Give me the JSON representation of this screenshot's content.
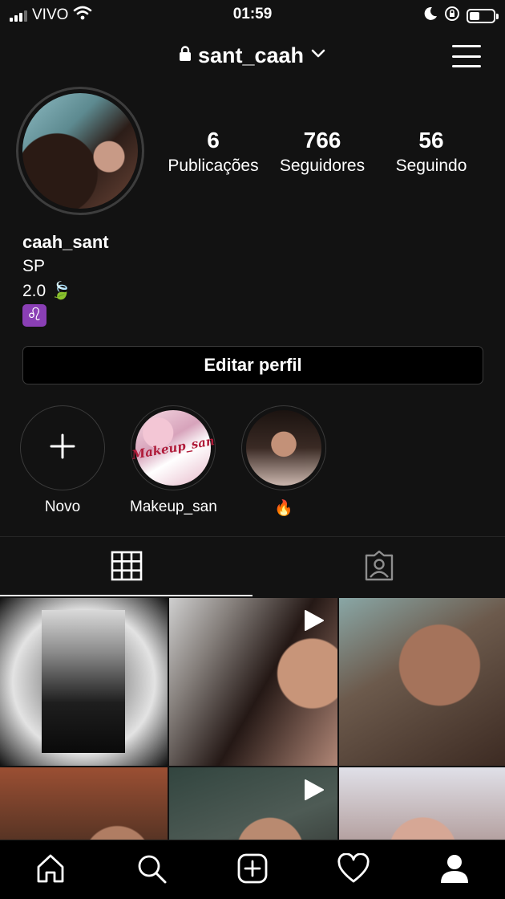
{
  "status_bar": {
    "carrier": "VIVO",
    "time": "01:59"
  },
  "header": {
    "username": "sant_caah"
  },
  "profile": {
    "stats": [
      {
        "value": "6",
        "label": "Publicações"
      },
      {
        "value": "766",
        "label": "Seguidores"
      },
      {
        "value": "56",
        "label": "Seguindo"
      }
    ],
    "bio": {
      "name": "caah_sant",
      "line1": "SP",
      "line2_text": "2.0",
      "line2_emoji": "🍃",
      "line3_emoji": "♌"
    },
    "edit_button": "Editar perfil"
  },
  "highlights": [
    {
      "label": "Novo"
    },
    {
      "label": "Makeup_san",
      "cover_text": "Makeup_san"
    },
    {
      "label": "🔥"
    }
  ],
  "tabs": [
    "grid-posts",
    "tagged-posts"
  ],
  "posts": [
    {
      "type": "photo"
    },
    {
      "type": "video"
    },
    {
      "type": "photo"
    },
    {
      "type": "photo"
    },
    {
      "type": "video"
    },
    {
      "type": "photo"
    }
  ],
  "bottom_nav": [
    "home-icon",
    "search-icon",
    "new-post-icon",
    "activity-heart-icon",
    "profile-icon"
  ],
  "colors": {
    "background": "#121212",
    "nav_background": "#000000",
    "text": "#ffffff",
    "border": "#3a3a3a",
    "leo_badge": "#8a3fb5"
  }
}
